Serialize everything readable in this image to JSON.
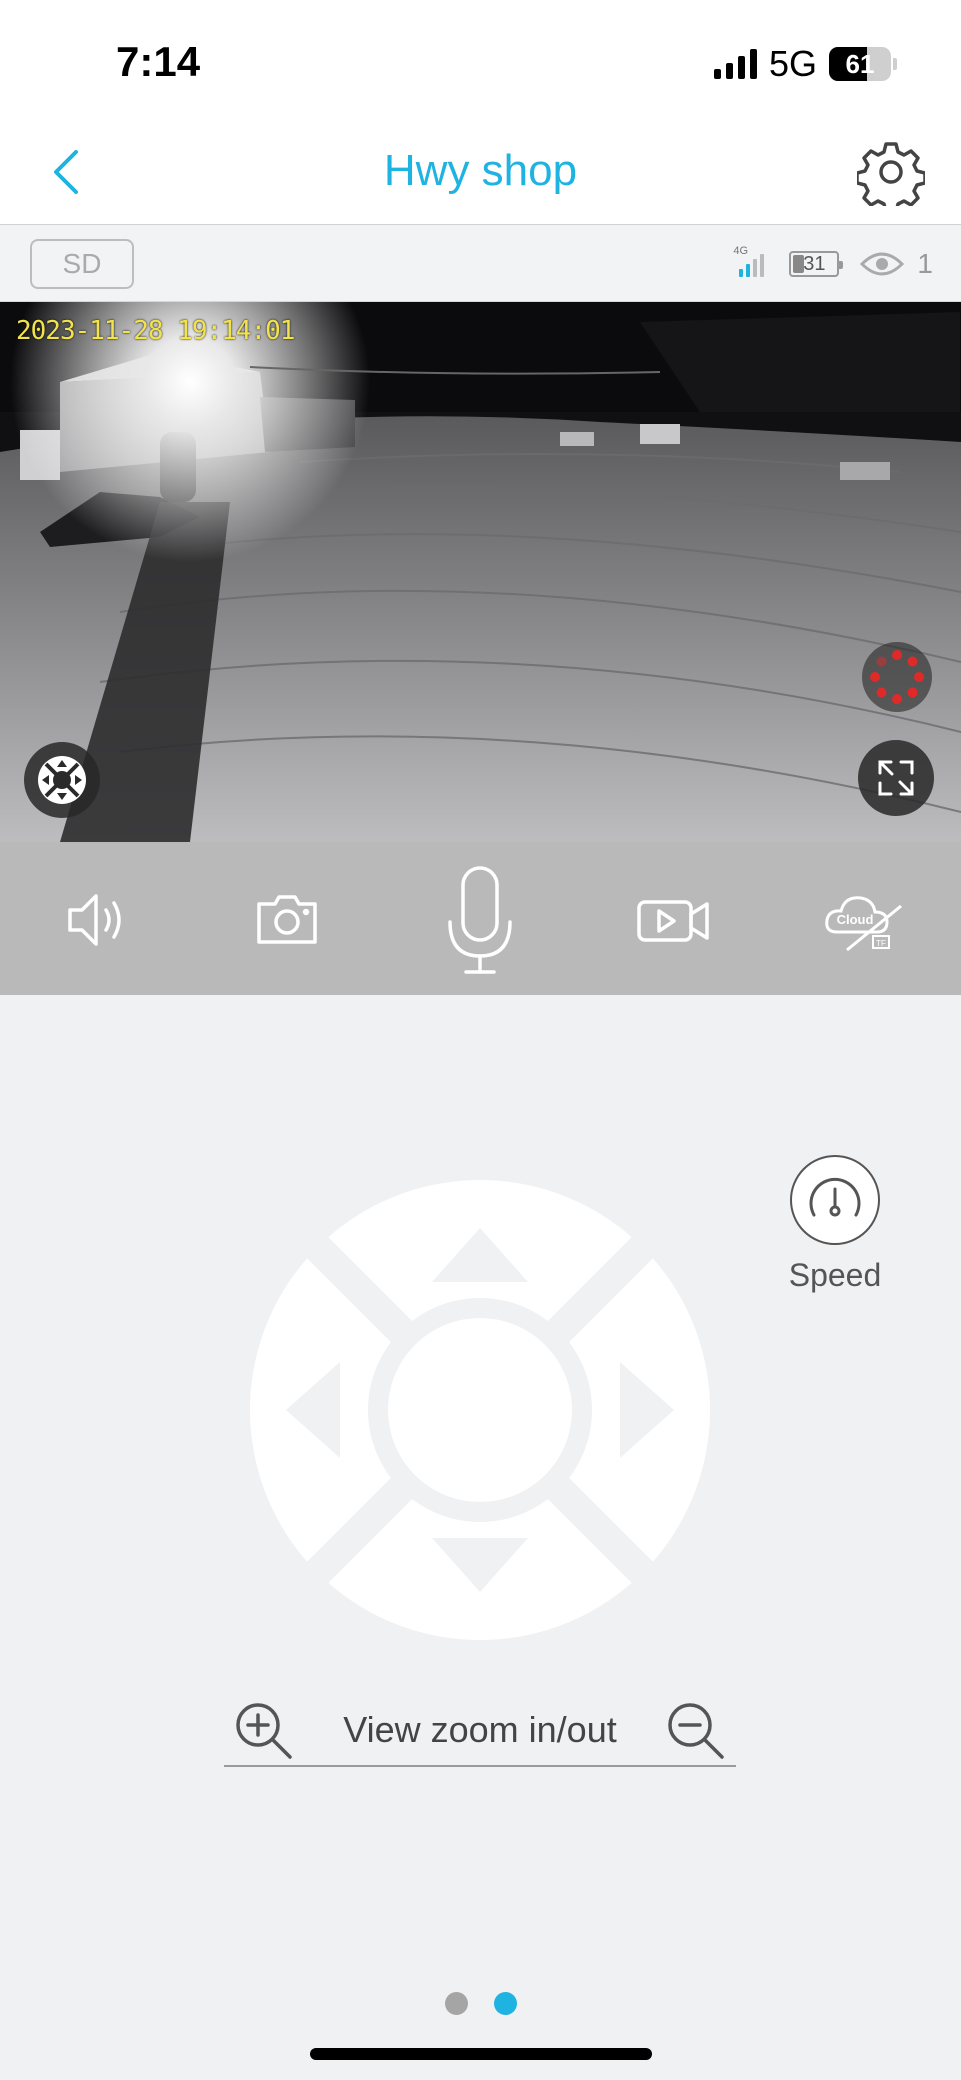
{
  "status_bar": {
    "time": "7:14",
    "network": "5G",
    "battery_level": "61",
    "battery_fraction": 0.61,
    "signal_bars": 4
  },
  "nav": {
    "title": "Hwy shop",
    "back_icon": "chevron-left-icon",
    "settings_icon": "gear-icon"
  },
  "camera_bar": {
    "quality_label": "SD",
    "network_type": "4G",
    "signal_bars": 2,
    "battery_level": "31",
    "battery_fraction": 0.31,
    "viewers_icon": "eye-icon",
    "viewers_count": "1"
  },
  "video": {
    "timestamp": "2023-11-28  19:14:01",
    "ptz_toggle_icon": "ptz-joystick-icon",
    "recording_icon": "loading-spinner-icon",
    "fullscreen_icon": "expand-icon"
  },
  "toolbar": {
    "items": [
      {
        "icon": "speaker-icon"
      },
      {
        "icon": "camera-snapshot-icon"
      },
      {
        "icon": "microphone-icon"
      },
      {
        "icon": "video-record-icon"
      },
      {
        "icon": "cloud-disabled-icon",
        "text": "Cloud",
        "badge": "TF"
      }
    ]
  },
  "controls": {
    "speed_label": "Speed",
    "speed_icon": "speedometer-icon",
    "ptz_icons": [
      "arrow-up-icon",
      "arrow-down-icon",
      "arrow-left-icon",
      "arrow-right-icon"
    ],
    "zoom_label": "View zoom in/out",
    "zoom_in_icon": "zoom-in-icon",
    "zoom_out_icon": "zoom-out-icon"
  },
  "pager": {
    "pages": 2,
    "active_index": 1
  },
  "colors": {
    "accent": "#1fb3e2",
    "toolbar_bg": "#b9b9b9",
    "page_bg": "#f0f1f3",
    "timestamp": "#f3e34a",
    "record_red": "#e02a2a",
    "pager_inactive": "#a5a5a5"
  }
}
